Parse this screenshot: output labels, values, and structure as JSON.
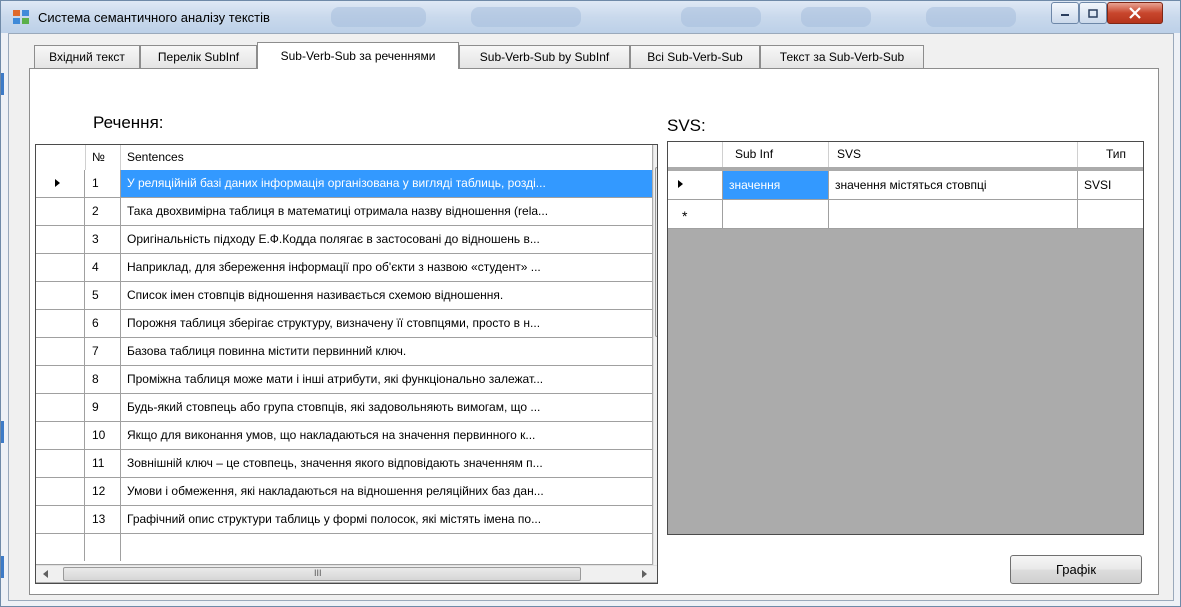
{
  "window": {
    "title": "Система семантичного аналізу текстів"
  },
  "tabs": [
    {
      "label": "Вхідний текст",
      "active": false
    },
    {
      "label": "Перелік SubInf",
      "active": false
    },
    {
      "label": "Sub-Verb-Sub за реченнями",
      "active": true
    },
    {
      "label": "Sub-Verb-Sub by SubInf",
      "active": false
    },
    {
      "label": "Всі Sub-Verb-Sub",
      "active": false
    },
    {
      "label": "Текст за Sub-Verb-Sub",
      "active": false
    }
  ],
  "left_panel": {
    "label": "Речення:",
    "columns": {
      "num": "№",
      "sentences": "Sentences"
    },
    "rows": [
      {
        "n": "1",
        "text": "У реляційній базі даних інформація організована у вигляді таблиць, розді..."
      },
      {
        "n": "2",
        "text": "Така двохвимірна таблиця в математиці отримала назву відношення (rela..."
      },
      {
        "n": "3",
        "text": "Оригінальність підходу Е.Ф.Кодда полягає в застосовані до відношень в..."
      },
      {
        "n": "4",
        "text": "Наприклад, для збереження інформації про об'єкти з назвою «студент» ..."
      },
      {
        "n": "5",
        "text": "Список імен стовпців відношення називається схемою відношення."
      },
      {
        "n": "6",
        "text": "Порожня таблиця зберігає структуру, визначену її стовпцями, просто в н..."
      },
      {
        "n": "7",
        "text": "Базова таблиця повинна містити первинний ключ."
      },
      {
        "n": "8",
        "text": "Проміжна таблиця може мати і інші атрибути, які функціонально залежат..."
      },
      {
        "n": "9",
        "text": "Будь-який стовпець або група стовпців, які задовольняють вимогам, що ..."
      },
      {
        "n": "10",
        "text": "Якщо для виконання умов, що накладаються на значення первинного к..."
      },
      {
        "n": "11",
        "text": "Зовнішній ключ – це стовпець, значення якого відповідають значенням п..."
      },
      {
        "n": "12",
        "text": "Умови і обмеження, які накладаються на відношення реляційних баз дан..."
      },
      {
        "n": "13",
        "text": "Графічний опис структури таблиць у формі полосок, які містять імена по..."
      }
    ],
    "selected_row": 1,
    "hscroll_grip": "III"
  },
  "right_panel": {
    "label": "SVS:",
    "columns": {
      "sub_inf": "Sub Inf",
      "svs": "SVS",
      "type": "Тип"
    },
    "rows": [
      {
        "sub_inf": "значення",
        "svs": "значення містяться стовпці",
        "type": "SVSI"
      }
    ],
    "new_row_marker": "*"
  },
  "buttons": {
    "graph": "Графік"
  },
  "colors": {
    "selection": "#3399ff",
    "titlebar": "#c9d9ec",
    "close": "#c8462d"
  }
}
